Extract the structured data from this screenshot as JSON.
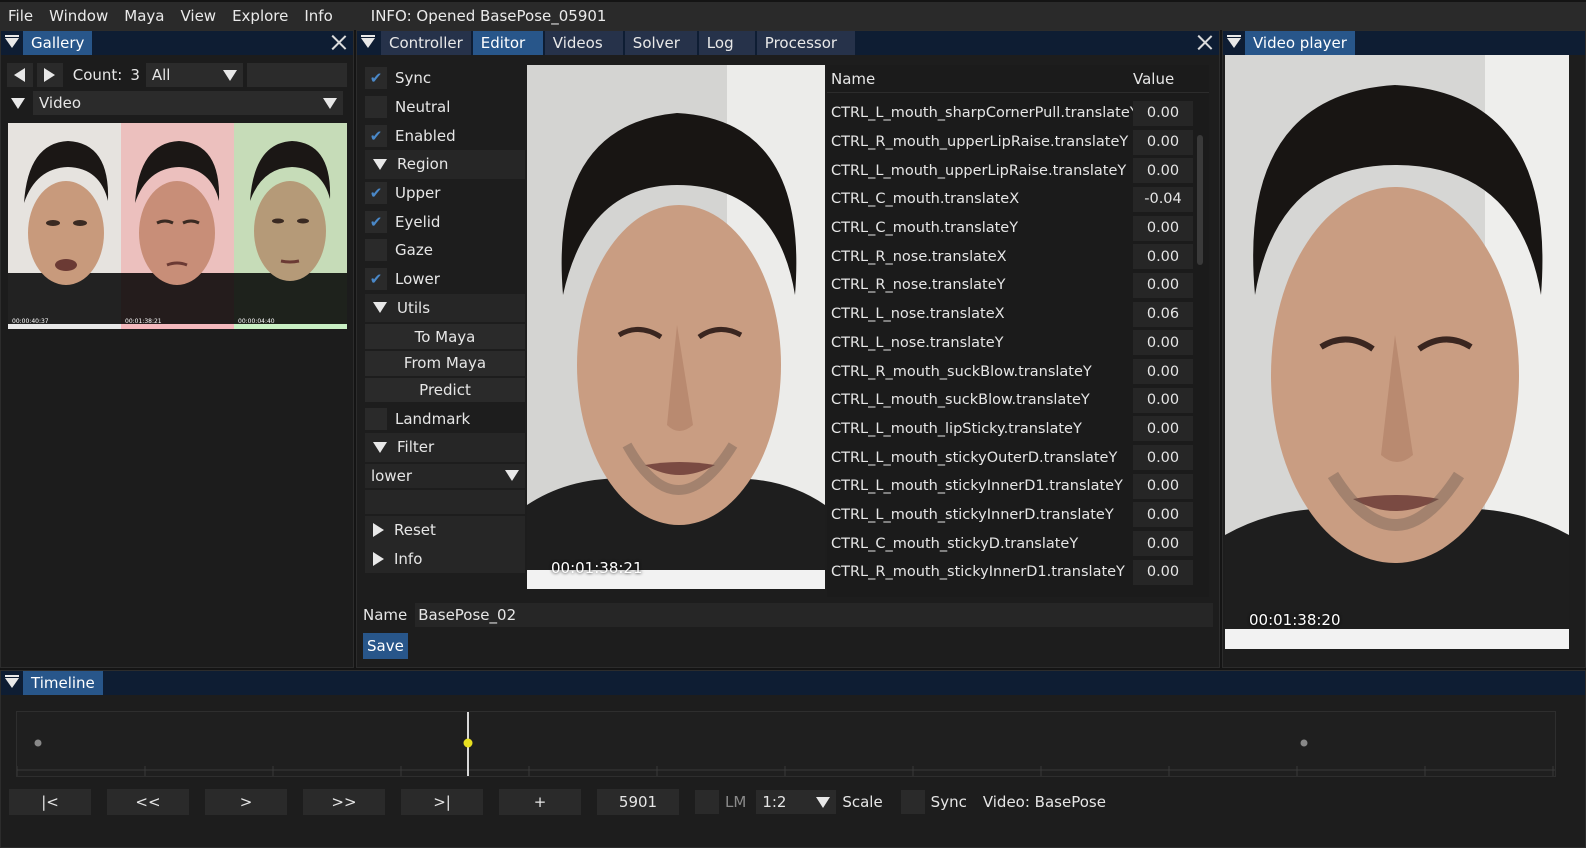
{
  "menu": {
    "items": [
      "File",
      "Window",
      "Maya",
      "View",
      "Explore",
      "Info"
    ],
    "info": "INFO: Opened BasePose_05901"
  },
  "gallery": {
    "title": "Gallery",
    "count_label": "Count:",
    "count_value": "3",
    "filter_value": "All",
    "source_value": "Video",
    "thumbnails": [
      {
        "timecode": "00:00:40:37",
        "tint": "#e8e8e8"
      },
      {
        "timecode": "00:01:38:21",
        "tint": "#f4b8bd"
      },
      {
        "timecode": "00:00:04:40",
        "tint": "#c9f0c4"
      }
    ]
  },
  "editor": {
    "tabs": [
      "Controller",
      "Editor",
      "Videos",
      "Solver",
      "Log",
      "Processor"
    ],
    "active_tab": "Editor",
    "controls": {
      "sync": "Sync",
      "neutral": "Neutral",
      "enabled": "Enabled",
      "region": "Region",
      "upper": "Upper",
      "eyelid": "Eyelid",
      "gaze": "Gaze",
      "lower": "Lower",
      "utils": "Utils",
      "to_maya": "To Maya",
      "from_maya": "From Maya",
      "predict": "Predict",
      "landmark": "Landmark",
      "filter": "Filter",
      "filter_value": "lower",
      "reset": "Reset",
      "info": "Info"
    },
    "video_timecode": "00:01:38:21",
    "table": {
      "col_name": "Name",
      "col_value": "Value",
      "rows": [
        {
          "name": "CTRL_L_mouth_sharpCornerPull.translateY",
          "value": "0.00"
        },
        {
          "name": "CTRL_R_mouth_upperLipRaise.translateY",
          "value": "0.00"
        },
        {
          "name": "CTRL_L_mouth_upperLipRaise.translateY",
          "value": "0.00"
        },
        {
          "name": "CTRL_C_mouth.translateX",
          "value": "-0.04"
        },
        {
          "name": "CTRL_C_mouth.translateY",
          "value": "0.00"
        },
        {
          "name": "CTRL_R_nose.translateX",
          "value": "0.00"
        },
        {
          "name": "CTRL_R_nose.translateY",
          "value": "0.00"
        },
        {
          "name": "CTRL_L_nose.translateX",
          "value": "0.06"
        },
        {
          "name": "CTRL_L_nose.translateY",
          "value": "0.00"
        },
        {
          "name": "CTRL_R_mouth_suckBlow.translateY",
          "value": "0.00"
        },
        {
          "name": "CTRL_L_mouth_suckBlow.translateY",
          "value": "0.00"
        },
        {
          "name": "CTRL_L_mouth_lipSticky.translateY",
          "value": "0.00"
        },
        {
          "name": "CTRL_L_mouth_stickyOuterD.translateY",
          "value": "0.00"
        },
        {
          "name": "CTRL_L_mouth_stickyInnerD1.translateY",
          "value": "0.00"
        },
        {
          "name": "CTRL_L_mouth_stickyInnerD.translateY",
          "value": "0.00"
        },
        {
          "name": "CTRL_C_mouth_stickyD.translateY",
          "value": "0.00"
        },
        {
          "name": "CTRL_R_mouth_stickyInnerD1.translateY",
          "value": "0.00"
        }
      ]
    },
    "name_label": "Name",
    "name_value": "BasePose_02",
    "save_label": "Save"
  },
  "player": {
    "title": "Video player",
    "timecode": "00:01:38:20"
  },
  "timeline": {
    "title": "Timeline",
    "buttons": [
      "|<",
      "<<",
      ">",
      ">>",
      ">|",
      "+"
    ],
    "frame": "5901",
    "lm_label": "LM",
    "ratio": "1:2",
    "scale_label": "Scale",
    "sync_label": "Sync",
    "video_label": "Video: BasePose"
  },
  "colors": {
    "accent": "#28568a",
    "title_bg": "#0e1d33",
    "check": "#4a88c8",
    "playhead": "#e8e020"
  }
}
